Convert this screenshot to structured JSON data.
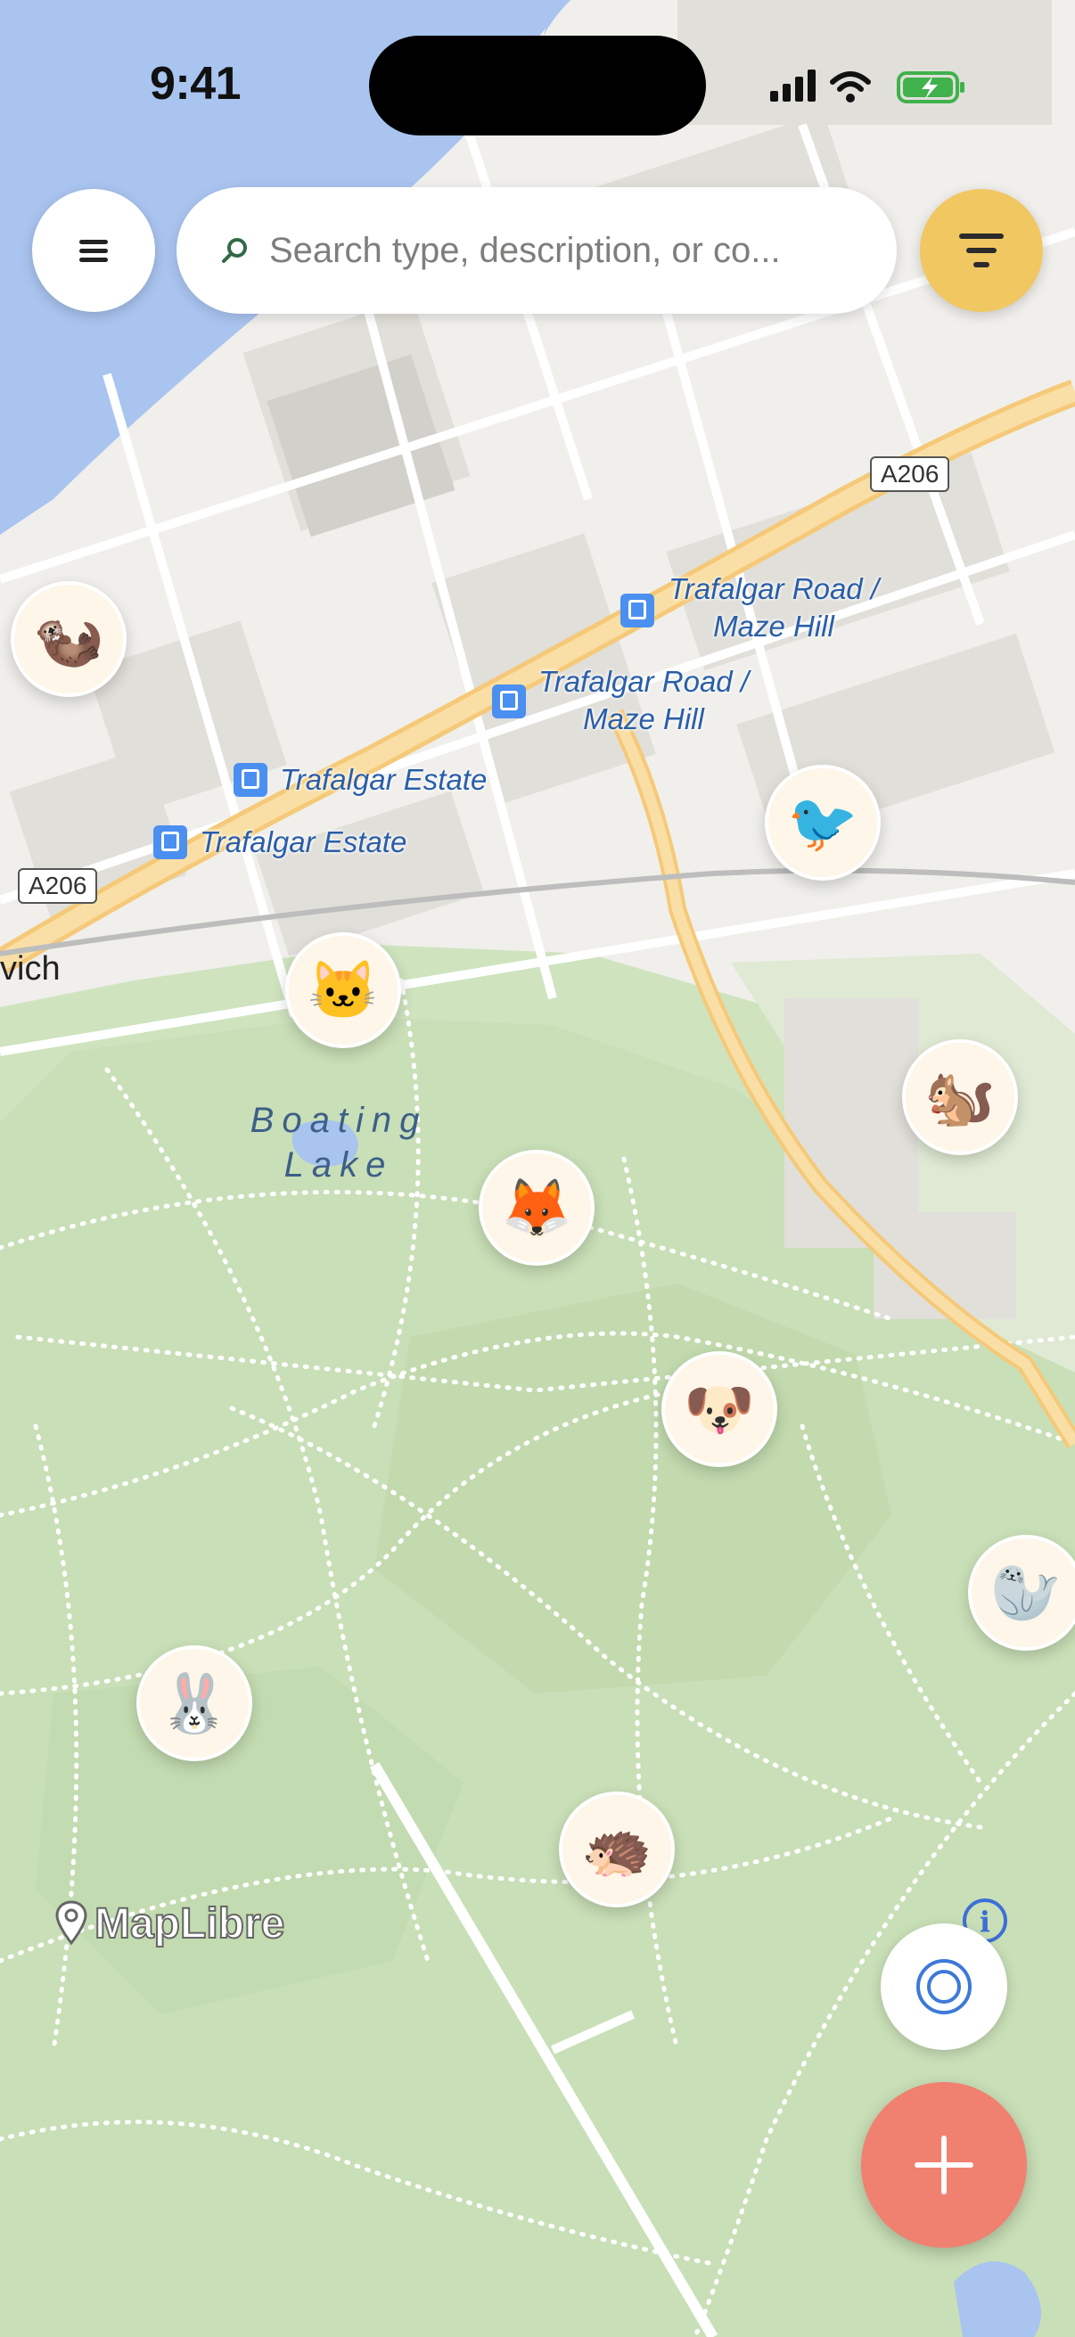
{
  "status_bar": {
    "time": "9:41"
  },
  "search": {
    "placeholder": "Search type, description, or co..."
  },
  "map": {
    "road_labels": [
      "A206",
      "A206"
    ],
    "bus_stops": [
      "Trafalgar Road / Maze Hill",
      "Trafalgar Road / Maze Hill",
      "Trafalgar Estate",
      "Trafalgar Estate"
    ],
    "lake_label": "Boating Lake",
    "place_label": "vich",
    "attribution": "MapLibre"
  },
  "pins": [
    {
      "animal": "otter",
      "emoji": "🦦"
    },
    {
      "animal": "bird",
      "emoji": "🐦"
    },
    {
      "animal": "cat",
      "emoji": "🐱"
    },
    {
      "animal": "chipmunk",
      "emoji": "🐿️"
    },
    {
      "animal": "fox",
      "emoji": "🦊"
    },
    {
      "animal": "dog",
      "emoji": "🐶"
    },
    {
      "animal": "seal",
      "emoji": "🦭"
    },
    {
      "animal": "rabbit",
      "emoji": "🐰"
    },
    {
      "animal": "hedgehog",
      "emoji": "🦔"
    }
  ],
  "colors": {
    "filter_button": "#f1c761",
    "add_button": "#f08070",
    "accent_blue": "#3d79d9"
  },
  "icons": {
    "menu": "hamburger-icon",
    "search": "search-icon",
    "filter": "filter-icon",
    "info": "info-icon",
    "locate": "locate-icon",
    "add": "plus-icon"
  }
}
